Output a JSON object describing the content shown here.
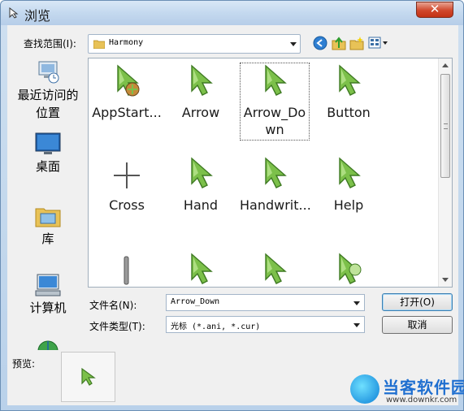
{
  "window": {
    "title": "浏览",
    "close_symbol": "✕"
  },
  "lookin": {
    "label": "查找范围(I):",
    "value": "Harmony"
  },
  "toolbar": {
    "icons": [
      "back-icon",
      "up-folder-icon",
      "new-folder-icon",
      "view-menu-icon"
    ]
  },
  "places": [
    {
      "label": "最近访问的位置",
      "icon": "recent-places-icon"
    },
    {
      "label": "桌面",
      "icon": "desktop-icon"
    },
    {
      "label": "库",
      "icon": "libraries-icon"
    },
    {
      "label": "计算机",
      "icon": "computer-icon"
    },
    {
      "label": "",
      "icon": "network-icon"
    }
  ],
  "files": [
    {
      "name": "AppStart...",
      "icon": "appstarting-cursor-icon"
    },
    {
      "name": "Arrow",
      "icon": "arrow-cursor-icon"
    },
    {
      "name": "Arrow_Do\nwn",
      "icon": "arrow-down-cursor-icon",
      "selected": true
    },
    {
      "name": "Button",
      "icon": "button-cursor-icon"
    },
    {
      "name": "Cross",
      "icon": "cross-cursor-icon"
    },
    {
      "name": "Hand",
      "icon": "hand-cursor-icon"
    },
    {
      "name": "Handwrit...",
      "icon": "handwriting-cursor-icon"
    },
    {
      "name": "Help",
      "icon": "help-cursor-icon"
    },
    {
      "name": "",
      "icon": "ibeam-cursor-icon"
    },
    {
      "name": "",
      "icon": "arrow-cursor-icon"
    },
    {
      "name": "",
      "icon": "arrow-cursor-icon"
    },
    {
      "name": "",
      "icon": "busy-cursor-icon"
    }
  ],
  "filename": {
    "label": "文件名(N):",
    "value": "Arrow_Down"
  },
  "filetype": {
    "label": "文件类型(T):",
    "value": "光标 (*.ani, *.cur)"
  },
  "buttons": {
    "open": "打开(O)",
    "cancel": "取消"
  },
  "preview": {
    "label": "预览:"
  },
  "watermark": {
    "name": "当客软件园",
    "url": "www.downkr.com"
  },
  "colors": {
    "cursor_green": "#7cc04a",
    "cursor_dark": "#3f7a23",
    "accent": "#3c7fb1"
  }
}
